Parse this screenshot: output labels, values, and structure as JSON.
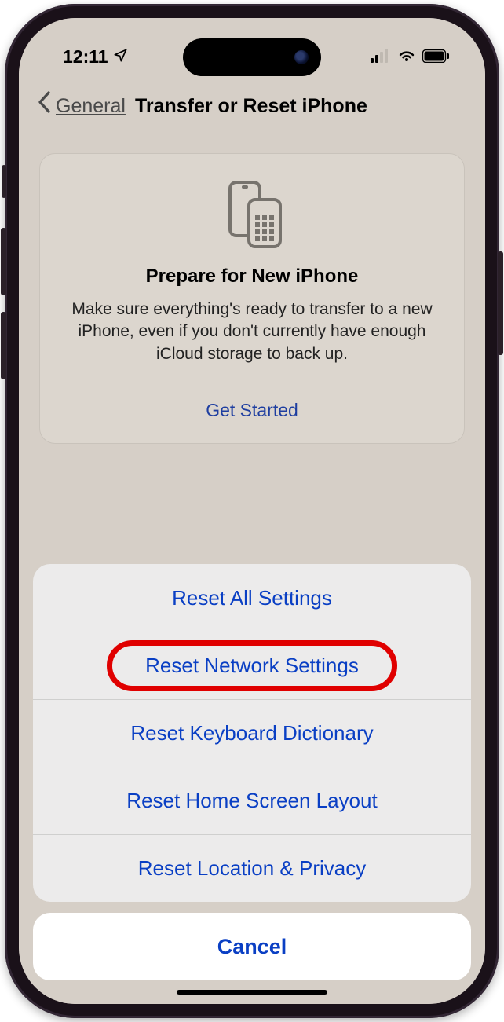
{
  "statusBar": {
    "time": "12:11",
    "locationIcon": "location-arrow"
  },
  "nav": {
    "back": "General",
    "title": "Transfer or Reset iPhone"
  },
  "prepare": {
    "title": "Prepare for New iPhone",
    "description": "Make sure everything's ready to transfer to a new iPhone, even if you don't currently have enough iCloud storage to back up.",
    "action": "Get Started"
  },
  "sheet": {
    "items": [
      "Reset All Settings",
      "Reset Network Settings",
      "Reset Keyboard Dictionary",
      "Reset Home Screen Layout",
      "Reset Location & Privacy"
    ],
    "highlighted_index": 1,
    "cancel": "Cancel"
  }
}
